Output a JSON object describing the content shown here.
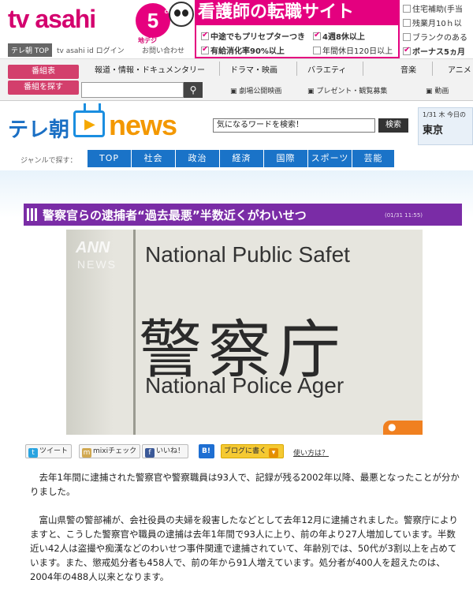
{
  "header": {
    "logo_text": "tv asahi",
    "channel": "5",
    "channel_small": "ch",
    "chideji": "地デジ",
    "links": [
      "テレ朝 TOP",
      "tv asahi id ログイン",
      "お問い合わせ"
    ]
  },
  "ad": {
    "title": "看護師の転職サイト",
    "items": [
      {
        "label": "中途でもプリセプターつき",
        "checked": true
      },
      {
        "label": "4週8休以上",
        "checked": true
      },
      {
        "label": "有給消化率90%以上",
        "checked": true
      },
      {
        "label": "年間休日120日以上",
        "checked": false
      }
    ],
    "side_items": [
      {
        "label": "住宅補助(手当",
        "checked": false
      },
      {
        "label": "残業月10ｈ以",
        "checked": false
      },
      {
        "label": "ブランクのある",
        "checked": false
      },
      {
        "label": "ボーナス5ヵ月",
        "checked": true
      }
    ]
  },
  "mainnav": {
    "buttons": [
      "番組表",
      "番組を探す"
    ],
    "items": [
      "報道・情報・ドキュメンタリー",
      "ドラマ・映画",
      "バラエティ",
      "音楽",
      "アニメ"
    ],
    "subitems": [
      "劇場公開映画",
      "プレゼント・観覧募集",
      "動画"
    ]
  },
  "newsheader": {
    "brand_prefix": "テレ朝",
    "brand_word": "news",
    "search_value": "気になるワードを検索！",
    "search_button": "検索",
    "weather_date": "1/31 木 今日の",
    "weather_city": "東京"
  },
  "genre": {
    "label": "ジャンルで探す：",
    "items": [
      "TOP",
      "社会",
      "政治",
      "経済",
      "国際",
      "スポーツ",
      "芸能"
    ]
  },
  "article": {
    "title": "警察官らの逮捕者“過去最悪”半数近くがわいせつ",
    "date": "(01/31 11:55)",
    "photo": {
      "line1": "National Public Safet",
      "line2": "警察庁",
      "line3": "National Police Ager",
      "watermark1": "ANN",
      "watermark2": "NEWS"
    },
    "paragraphs": [
      "去年1年間に逮捕された警察官や警察職員は93人で、記録が残る2002年以降、最悪となったことが分かりました。",
      "富山県警の警部補が、会社役員の夫婦を殺害したなどとして去年12月に逮捕されました。警察庁によりますと、こうした警察官や職員の逮捕は去年1年間で93人に上り、前の年より27人増加しています。半数近い42人は盗撮や痴漢などのわいせつ事件関連で逮捕されていて、年齢別では、50代が3割以上を占めています。また、懲戒処分者も458人で、前の年から91人増えています。処分者が400人を超えたのは、2004年の488人以来となります。"
    ]
  },
  "social": {
    "tweet": "ツイート",
    "mixi": "mixiチェック",
    "like": "いいね！",
    "hatena": "B!",
    "blog": "ブログに書く",
    "howto": "使い方は？"
  }
}
